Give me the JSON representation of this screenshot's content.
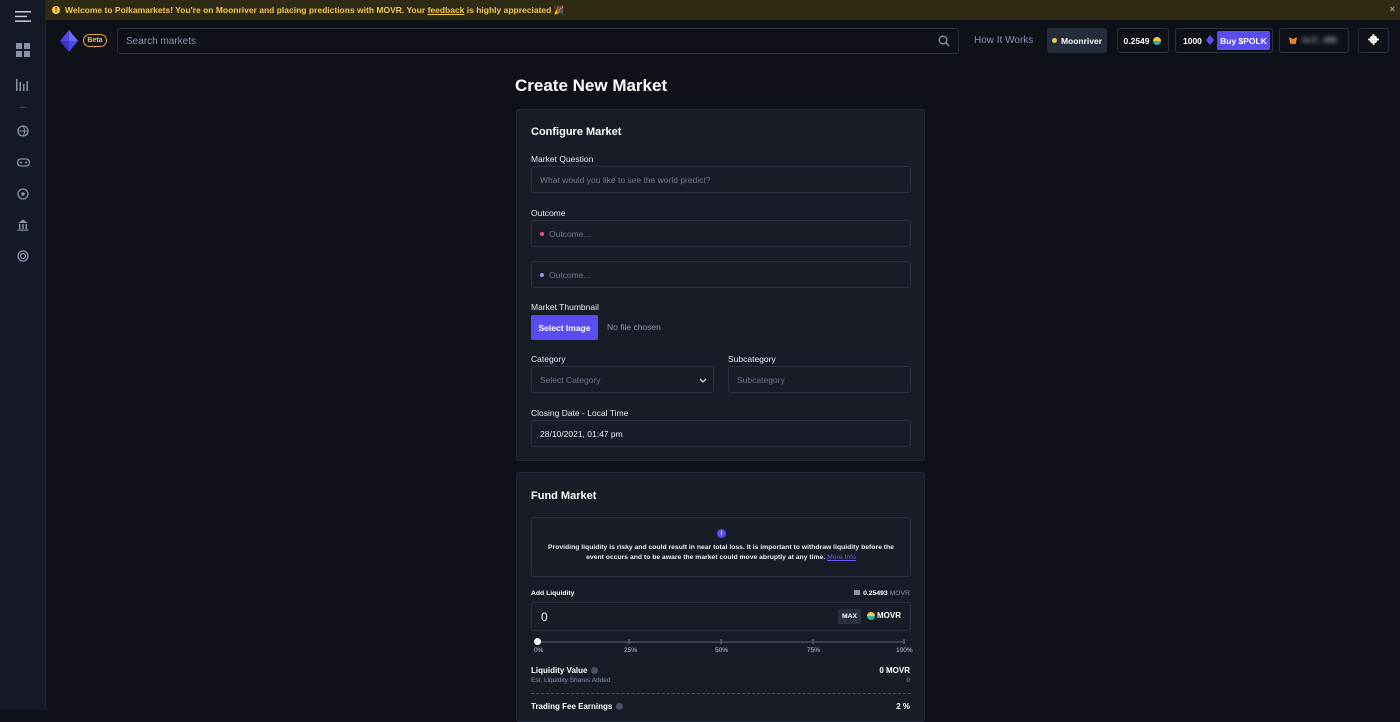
{
  "banner": {
    "text_before": "Welcome to Polkamarkets! You're on Moonriver and placing predictions with MOVR. Your ",
    "link": "feedback",
    "text_after": " is highly appreciated 🎉",
    "close": "×"
  },
  "header": {
    "beta": "Beta",
    "search_placeholder": "Search markets",
    "how_it_works": "How It Works",
    "network": "Moonriver",
    "balance": "0.2549",
    "polk_balance": "1000",
    "buy_button": "Buy $POLK",
    "wallet_address": "0x7f...8ff9"
  },
  "page": {
    "title": "Create New Market"
  },
  "configure": {
    "title": "Configure Market",
    "question_label": "Market Question",
    "question_placeholder": "What would you like to see the world predict?",
    "outcome_label": "Outcome",
    "outcome_placeholders": [
      "Outcome...",
      "Outcome..."
    ],
    "outcome_colors": [
      "#e8558a",
      "#a78bfa"
    ],
    "thumbnail_label": "Market Thumbnail",
    "select_image": "Select Image",
    "no_file": "No file chosen",
    "category_label": "Category",
    "category_value": "Select Category",
    "subcategory_label": "Subcategory",
    "subcategory_placeholder": "Subcategory",
    "closing_label": "Closing Date - Local Time",
    "closing_value": "28/10/2021, 01:47 pm"
  },
  "fund": {
    "title": "Fund Market",
    "notice_text": "Providing liquidity is risky and could result in near total loss. It is important to withdraw liquidity before the event occurs and to be aware the market could move abruptly at any time.",
    "more_info": "More Info",
    "add_liquidity_label": "Add Liquidity",
    "wallet_balance": "0.25493",
    "wallet_unit": "MOVR",
    "amount": "0",
    "max": "MAX",
    "token": "MOVR",
    "slider_value_pct": 0,
    "slider_labels": [
      "0%",
      "25%",
      "50%",
      "75%",
      "100%"
    ],
    "liquidity_value_label": "Liquidity Value",
    "liquidity_value": "0 MOVR",
    "shares_label": "Est. Liquidity Shares Added",
    "shares_value": "0",
    "fee_label": "Trading Fee Earnings",
    "fee_value": "2 %"
  }
}
